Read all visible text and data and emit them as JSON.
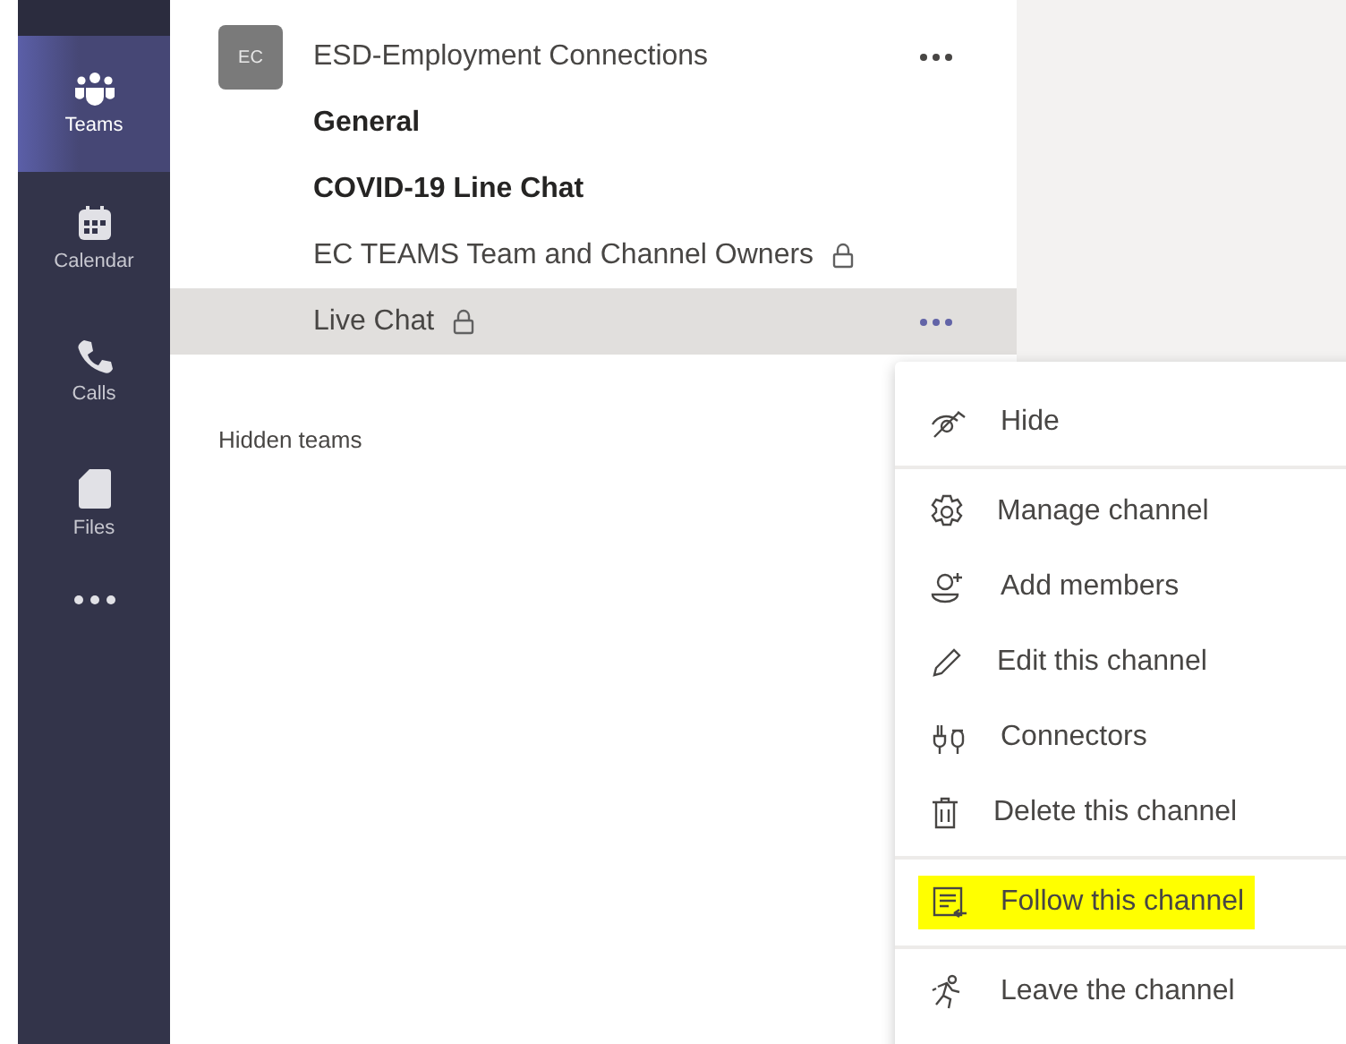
{
  "app_bar": {
    "items": [
      {
        "label": "Teams",
        "selected": true
      },
      {
        "label": "Calendar",
        "selected": false
      },
      {
        "label": "Calls",
        "selected": false
      },
      {
        "label": "Files",
        "selected": false
      }
    ]
  },
  "team": {
    "avatar": "EC",
    "name": "ESD-Employment Connections",
    "channels": [
      {
        "name": "General",
        "bold": true,
        "private": false,
        "selected": false
      },
      {
        "name": "COVID-19 Line Chat",
        "bold": true,
        "private": false,
        "selected": false
      },
      {
        "name": "EC TEAMS Team and Channel Owners",
        "bold": false,
        "private": true,
        "selected": false
      },
      {
        "name": "Live Chat",
        "bold": false,
        "private": true,
        "selected": true
      }
    ]
  },
  "hidden_teams": "Hidden teams",
  "context_menu": {
    "groups": [
      [
        {
          "label": "Hide",
          "highlighted": false
        }
      ],
      [
        {
          "label": "Manage channel",
          "highlighted": false
        },
        {
          "label": "Add members",
          "highlighted": false
        },
        {
          "label": "Edit this channel",
          "highlighted": false
        },
        {
          "label": "Connectors",
          "highlighted": false
        },
        {
          "label": "Delete this channel",
          "highlighted": false
        }
      ],
      [
        {
          "label": "Follow this channel",
          "highlighted": true
        }
      ],
      [
        {
          "label": "Leave the channel",
          "highlighted": false
        }
      ]
    ]
  }
}
